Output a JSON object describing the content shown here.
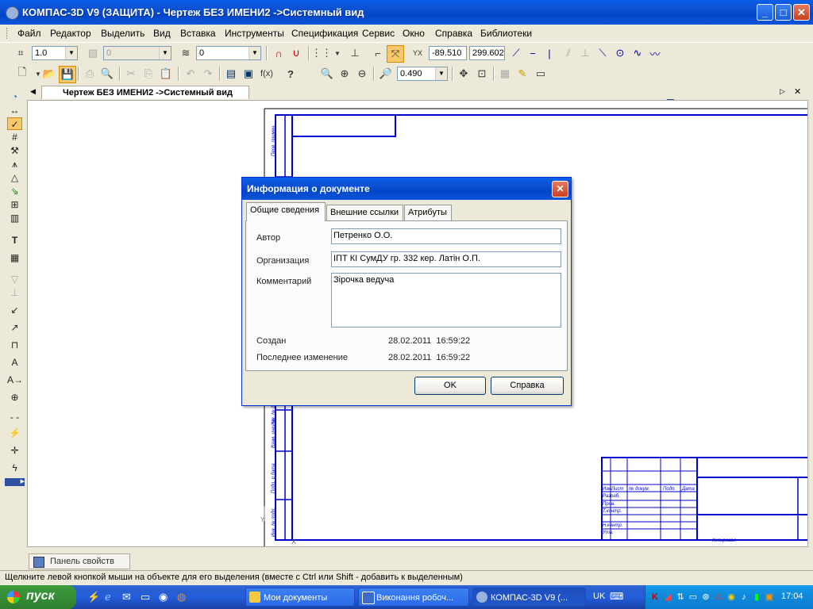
{
  "window": {
    "title": "КОМПАС-3D V9 (ЗАЩИТА) - Чертеж БЕЗ ИМЕНИ2 ->Системный вид"
  },
  "menu": [
    "Файл",
    "Редактор",
    "Выделить",
    "Вид",
    "Вставка",
    "Инструменты",
    "Спецификация",
    "Сервис",
    "Окно",
    "Справка",
    "Библиотеки"
  ],
  "toolbar1": {
    "scale_value": "1.0",
    "layer_disabled_value": "0",
    "state_value": "0",
    "coord_x": "-89.510",
    "coord_y": "299.602"
  },
  "toolbar2": {
    "zoom_value": "0.490"
  },
  "doc_tab": {
    "label": "Чертеж БЕЗ ИМЕНИ2 ->Системный вид"
  },
  "drawing": {
    "stamp_labels": [
      "Изм.",
      "Лист",
      "№ докум.",
      "Подп.",
      "Дата",
      "Разраб.",
      "Пров.",
      "Т.контр.",
      "Н.контр.",
      "Утв."
    ],
    "side_labels": [
      "Перв. примен.",
      "Инв. № дубл.",
      "Взам. инв. №",
      "Подп. и дата",
      "Инв. № подл."
    ],
    "copy_label": "Копировал"
  },
  "dialog": {
    "title": "Информация о документе",
    "tabs": [
      "Общие сведения",
      "Внешние ссылки",
      "Атрибуты"
    ],
    "active_tab": "Общие сведения",
    "fields": {
      "author_label": "Автор",
      "author_value": "Петренко О.О.",
      "org_label": "Организация",
      "org_value": "ІПТ КІ СумДУ гр. 332 кер. Латін О.П.",
      "comment_label": "Комментарий",
      "comment_value": "Зірочка ведуча",
      "created_label": "Создан",
      "created_value": "28.02.2011  16:59:22",
      "modified_label": "Последнее изменение",
      "modified_value": "28.02.2011  16:59:22"
    },
    "ok_label": "OK",
    "help_label": "Справка"
  },
  "property_panel": {
    "label": "Панель свойств"
  },
  "status": {
    "text": "Щелкните левой кнопкой мыши на объекте для его выделения (вместе с Ctrl или Shift - добавить к выделенным)"
  },
  "taskbar": {
    "start_label": "пуск",
    "tasks": [
      "Мои документы",
      "Виконання робоч...",
      "КОМПАС-3D V9 (..."
    ],
    "lang": "UK",
    "clock": "17:04"
  },
  "colors": {
    "xp_blue": "#0A5FE8",
    "drawing_line": "#0000CC",
    "start_green": "#3C9A3C"
  }
}
